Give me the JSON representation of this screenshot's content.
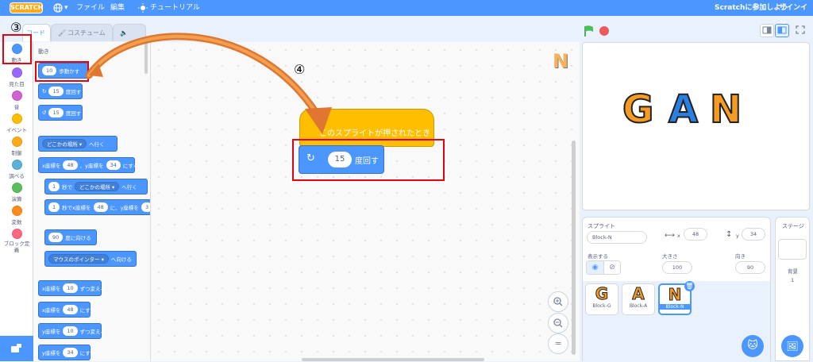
{
  "menubar": {
    "logo": "SCRATCH",
    "file": "ファイル",
    "edit": "編集",
    "tutorial": "チュートリアル",
    "join": "Scratchに参加しよう",
    "signin": "サインイン"
  },
  "tabs": {
    "code": "コード",
    "costumes": "コスチューム"
  },
  "categories": [
    {
      "label": "動き",
      "color": "#4c97ff"
    },
    {
      "label": "見た目",
      "color": "#9966ff"
    },
    {
      "label": "音",
      "color": "#cf63cf"
    },
    {
      "label": "イベント",
      "color": "#ffbf00"
    },
    {
      "label": "制御",
      "color": "#ffab19"
    },
    {
      "label": "調べる",
      "color": "#5cb1d6"
    },
    {
      "label": "演算",
      "color": "#59c059"
    },
    {
      "label": "変数",
      "color": "#ff8c1a"
    },
    {
      "label": "ブロック定義",
      "color": "#ff6680"
    }
  ],
  "palette": {
    "heading": "動き",
    "move": {
      "num": "10",
      "text": "歩動かす"
    },
    "turn_right": {
      "num": "15",
      "text": "度回す"
    },
    "turn_left": {
      "num": "15",
      "text": "度回す"
    },
    "goto": {
      "drop": "どこかの場所 ▾",
      "text": "へ行く"
    },
    "gotoxy": {
      "a": "x座標を",
      "x": "48",
      "b": "、y座標を",
      "y": "34",
      "c": "にする"
    },
    "glide": {
      "n": "1",
      "a": "秒で",
      "drop": "どこかの場所 ▾",
      "b": "へ行く"
    },
    "glidexy": {
      "n": "1",
      "a": "秒でx座標を",
      "x": "48",
      "b": "に、y座標を",
      "c": "3"
    },
    "point": {
      "num": "90",
      "text": "度に向ける"
    },
    "pointto": {
      "drop": "マウスのポインター ▾",
      "text": "へ向ける"
    },
    "changex": {
      "a": "x座標を",
      "num": "10",
      "b": "ずつ変える"
    },
    "setx": {
      "a": "x座標を",
      "num": "48",
      "b": "にする"
    },
    "changey": {
      "a": "y座標を",
      "num": "10",
      "b": "ずつ変える"
    },
    "sety": {
      "a": "y座標を",
      "num": "34",
      "b": "にする"
    }
  },
  "workspace": {
    "hat_text": "このスプライトが押されたとき",
    "turn_num": "15",
    "turn_text": "度回す",
    "step3": "③",
    "step4": "④",
    "zoom_reset": "="
  },
  "stage": {
    "letters": [
      "G",
      "A",
      "N"
    ]
  },
  "sprite_info": {
    "sprite_label": "スプライト",
    "name": "Block-N",
    "x_label": "x",
    "x": "48",
    "y_label": "y",
    "y": "34",
    "show_label": "表示する",
    "size_label": "大きさ",
    "size": "100",
    "direction_label": "向き",
    "direction": "90"
  },
  "sprites": [
    {
      "letter": "G",
      "name": "Block-G"
    },
    {
      "letter": "A",
      "name": "Block-A"
    },
    {
      "letter": "N",
      "name": "Block-N"
    }
  ],
  "stage_pane": {
    "title": "ステージ",
    "backdrop_label": "背景",
    "backdrop_count": "1"
  },
  "colors": {
    "accent": "#4c97ff",
    "highlight": "#e60012",
    "arrow": "#e0762f"
  }
}
